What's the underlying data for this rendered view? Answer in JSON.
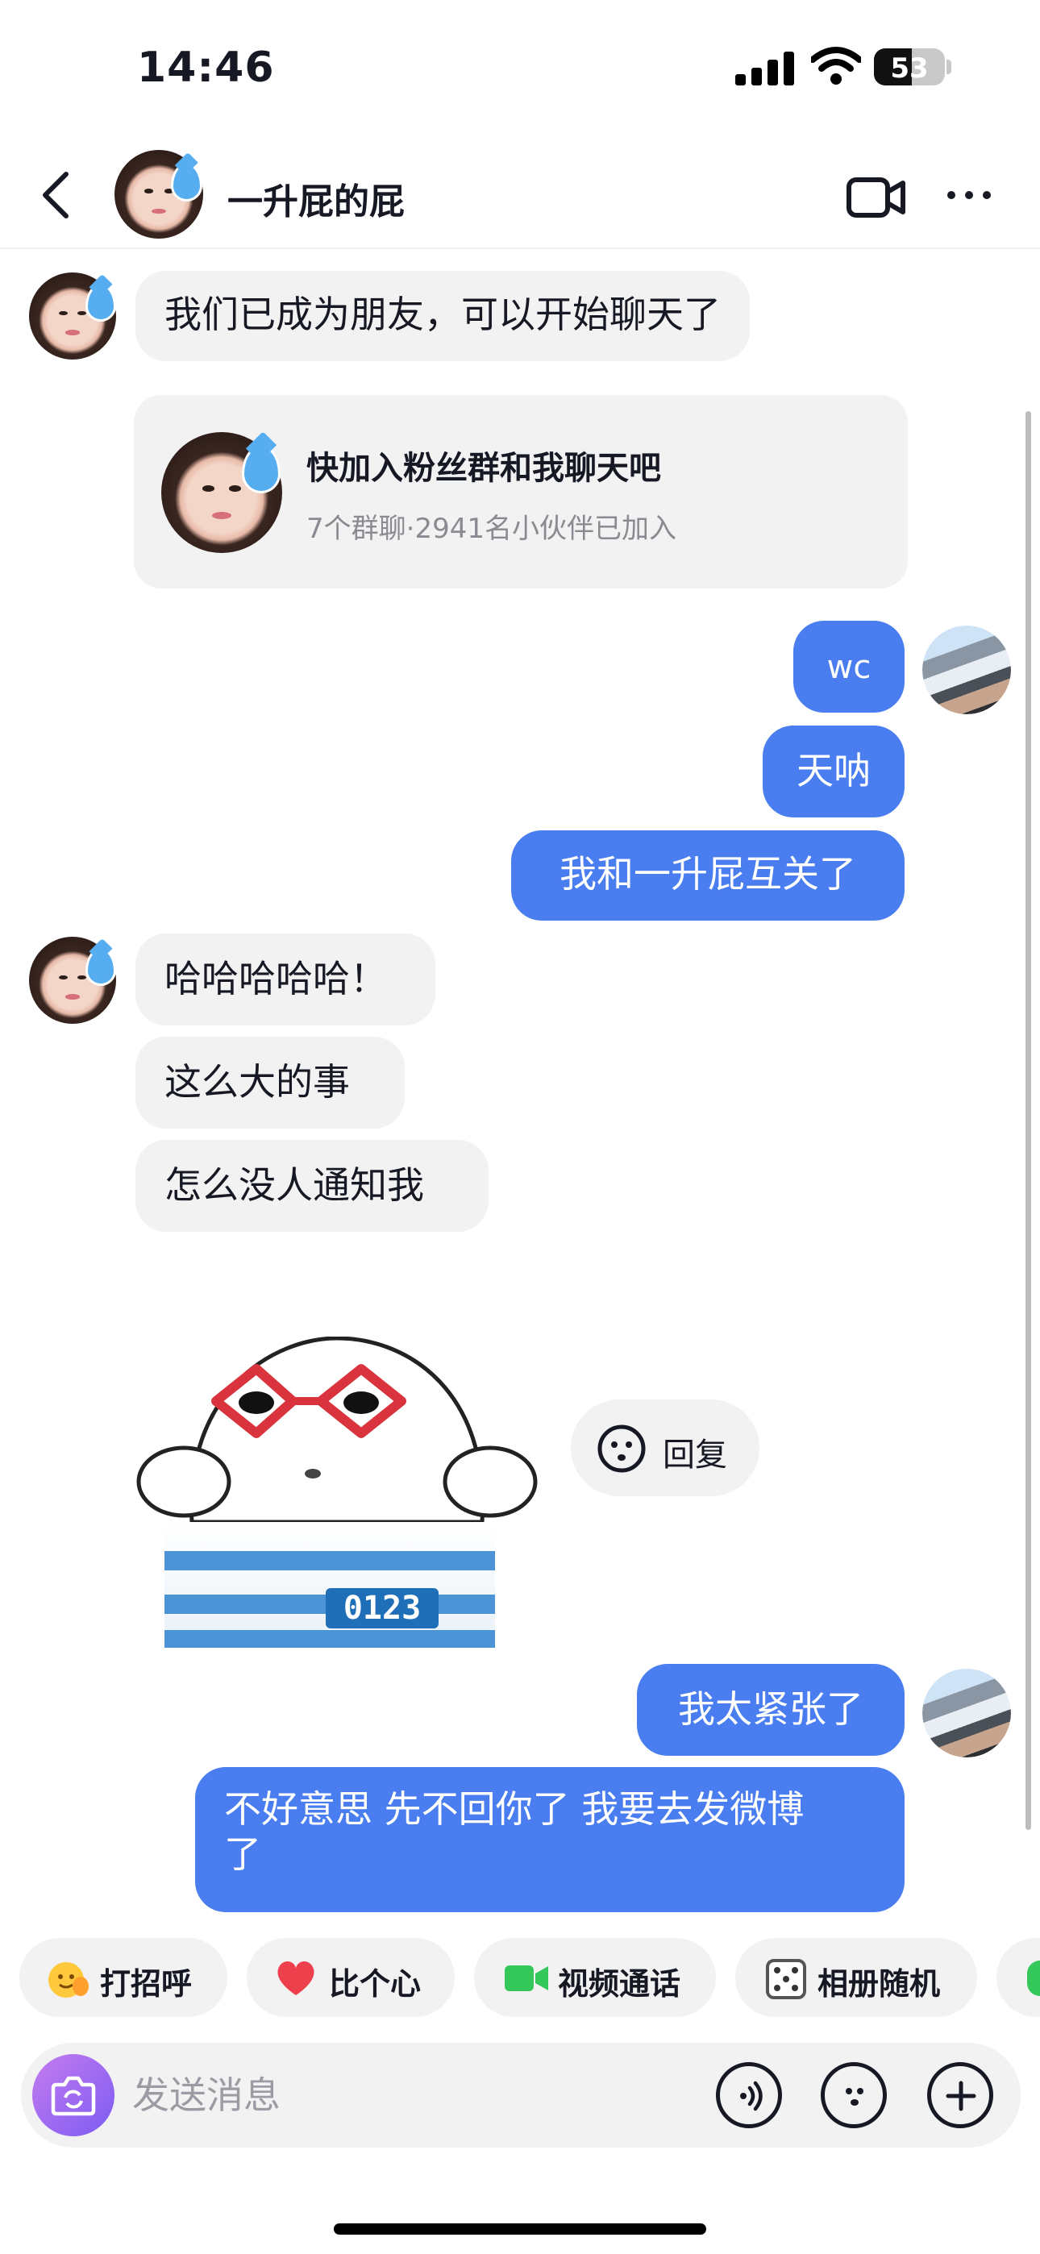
{
  "status_bar": {
    "time": "14:46",
    "battery": "53",
    "battery_fraction": 0.53
  },
  "header": {
    "title": "一升屁的屁"
  },
  "messages": {
    "m1": "我们已成为朋友，可以开始聊天了",
    "m2": "wc",
    "m3": "天呐",
    "m4": "我和一升屁互关了",
    "m5": "哈哈哈哈哈！",
    "m6": "这么大的事",
    "m7": "怎么没人通知我",
    "m8": "我太紧张了",
    "m9": "不好意思 先不回你了 我要去发微博",
    "m9_line2": "了"
  },
  "group_card": {
    "title": "快加入粉丝群和我聊天吧",
    "subtitle": "7个群聊·2941名小伙伴已加入"
  },
  "sticker": {
    "caption": "0123"
  },
  "reply_button": {
    "label": "回复"
  },
  "quick_replies": [
    {
      "label": "打招呼",
      "icon": "wave-emoji-icon"
    },
    {
      "label": "比个心",
      "icon": "heart-icon"
    },
    {
      "label": "视频通话",
      "icon": "video-call-icon"
    },
    {
      "label": "相册随机",
      "icon": "dice-icon"
    }
  ],
  "input": {
    "placeholder": "发送消息"
  },
  "colors": {
    "outgoing_bubble": "#4a7ef0",
    "incoming_bubble": "#f2f2f3",
    "accent_purple": "#8b5cf6"
  }
}
